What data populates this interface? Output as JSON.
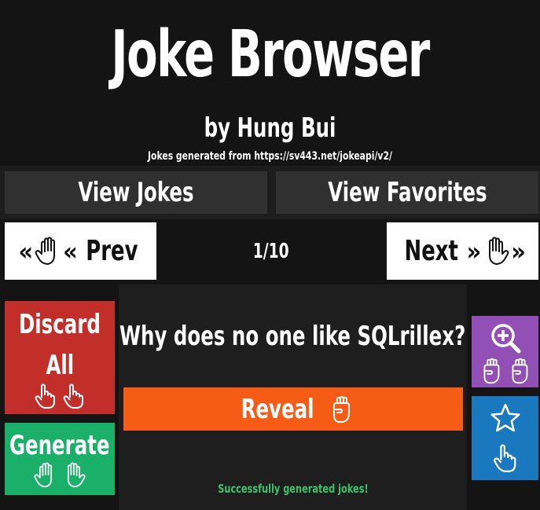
{
  "header": {
    "title": "Joke Browser",
    "author": "by Hung Bui",
    "source": "Jokes generated from https://sv443.net/jokeapi/v2/"
  },
  "tabs": [
    {
      "label": "View Jokes"
    },
    {
      "label": "View Favorites"
    }
  ],
  "nav": {
    "prev_label": "Prev",
    "next_label": "Next",
    "counter": "1/10",
    "prev_icons": [
      "double-chevron-left-icon",
      "raised-hand-icon",
      "double-chevron-left-icon"
    ],
    "next_icons": [
      "double-chevron-right-icon",
      "raised-hand-icon",
      "double-chevron-right-icon"
    ]
  },
  "joke": {
    "setup": "Why does no one like SQLrillex?",
    "reveal_label": "Reveal"
  },
  "actions": {
    "discard_label": "Discard All",
    "discard_line1": "Discard",
    "discard_line2": "All",
    "generate_label": "Generate"
  },
  "status": {
    "message": "Successfully generated jokes!"
  },
  "colors": {
    "background": "#141414",
    "tab": "#303030",
    "reveal": "#f75c17",
    "discard": "#c22f2b",
    "generate": "#1bb06a",
    "zoom": "#9250b6",
    "favorite": "#1a78bf",
    "status_text": "#3cc36b"
  }
}
